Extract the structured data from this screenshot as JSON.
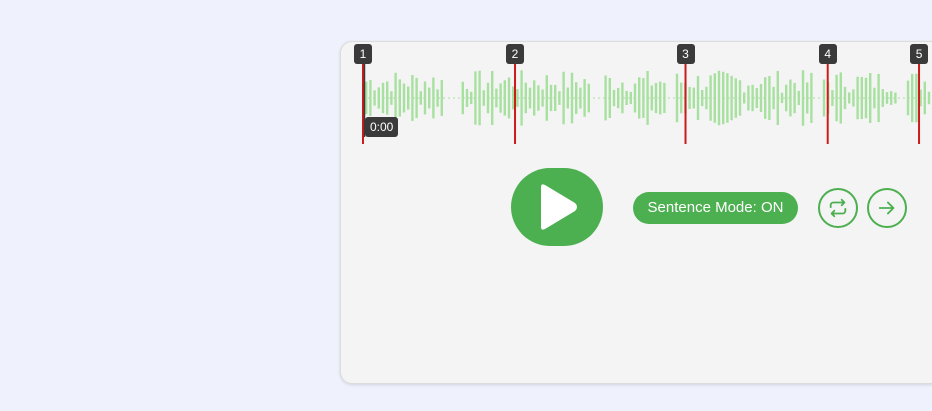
{
  "player": {
    "markers": [
      {
        "label": "1",
        "position": 0.0
      },
      {
        "label": "2",
        "position": 0.263
      },
      {
        "label": "3",
        "position": 0.558
      },
      {
        "label": "4",
        "position": 0.804
      },
      {
        "label": "5",
        "position": 0.962
      }
    ],
    "current_time": "0:00",
    "progress": 0.0,
    "sentence_mode_label": "Sentence Mode: ON",
    "play_icon": "play-icon",
    "loop_icon": "repeat-icon",
    "next_icon": "arrow-right-icon"
  },
  "colors": {
    "accent": "#4caf50",
    "waveform": "#a8e0a0",
    "marker_line": "#cc1b1b",
    "badge_bg": "#3a3a3a",
    "page_bg": "#eff1fc",
    "card_bg": "#f4f4f4"
  }
}
